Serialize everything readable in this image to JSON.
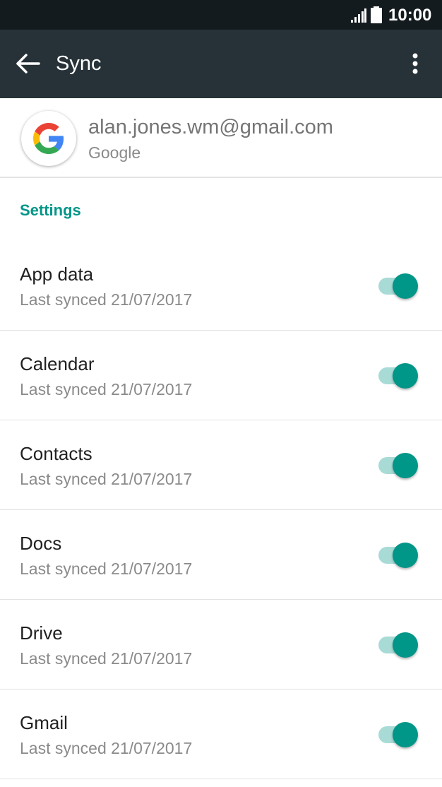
{
  "status_bar": {
    "time": "10:00",
    "signal_icon": "signal-icon",
    "battery_icon": "battery-icon"
  },
  "app_bar": {
    "title": "Sync",
    "back_icon": "arrow-back-icon",
    "overflow_icon": "more-vert-icon"
  },
  "account": {
    "email": "alan.jones.wm@gmail.com",
    "type": "Google",
    "logo_icon": "google-logo-icon"
  },
  "settings": {
    "header": "Settings",
    "items": [
      {
        "title": "App data",
        "subtitle": "Last synced 21/07/2017",
        "enabled": true
      },
      {
        "title": "Calendar",
        "subtitle": "Last synced 21/07/2017",
        "enabled": true
      },
      {
        "title": "Contacts",
        "subtitle": "Last synced 21/07/2017",
        "enabled": true
      },
      {
        "title": "Docs",
        "subtitle": "Last synced 21/07/2017",
        "enabled": true
      },
      {
        "title": "Drive",
        "subtitle": "Last synced 21/07/2017",
        "enabled": true
      },
      {
        "title": "Gmail",
        "subtitle": "Last synced 21/07/2017",
        "enabled": true
      }
    ]
  },
  "colors": {
    "status_bar": "#141b1f",
    "app_bar": "#263238",
    "accent": "#009688",
    "toggle_track": "#a8dbd6"
  }
}
